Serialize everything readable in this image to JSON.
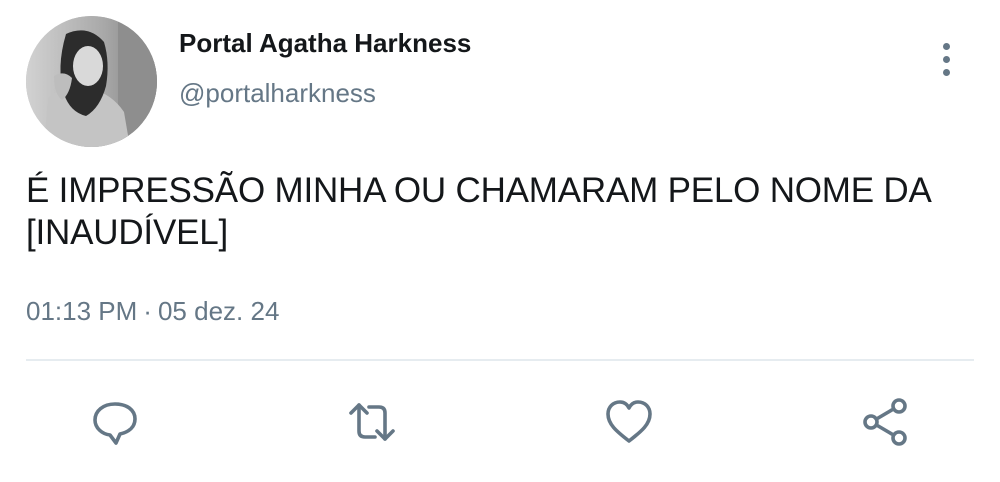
{
  "author": {
    "display_name": "Portal Agatha Harkness",
    "handle": "@portalharkness",
    "avatar_icon": "profile-photo"
  },
  "tweet": {
    "text": "É IMPRESSÃO MINHA OU CHAMARAM PELO NOME DA [INAUDÍVEL]",
    "time": "01:13 PM",
    "separator": "·",
    "date": "05 dez. 24"
  },
  "actions": {
    "reply_icon": "reply-icon",
    "retweet_icon": "retweet-icon",
    "like_icon": "heart-icon",
    "share_icon": "share-icon",
    "more_icon": "more-vertical-icon"
  },
  "colors": {
    "text": "#14171a",
    "secondary": "#657786",
    "divider": "#e6ecf0"
  }
}
